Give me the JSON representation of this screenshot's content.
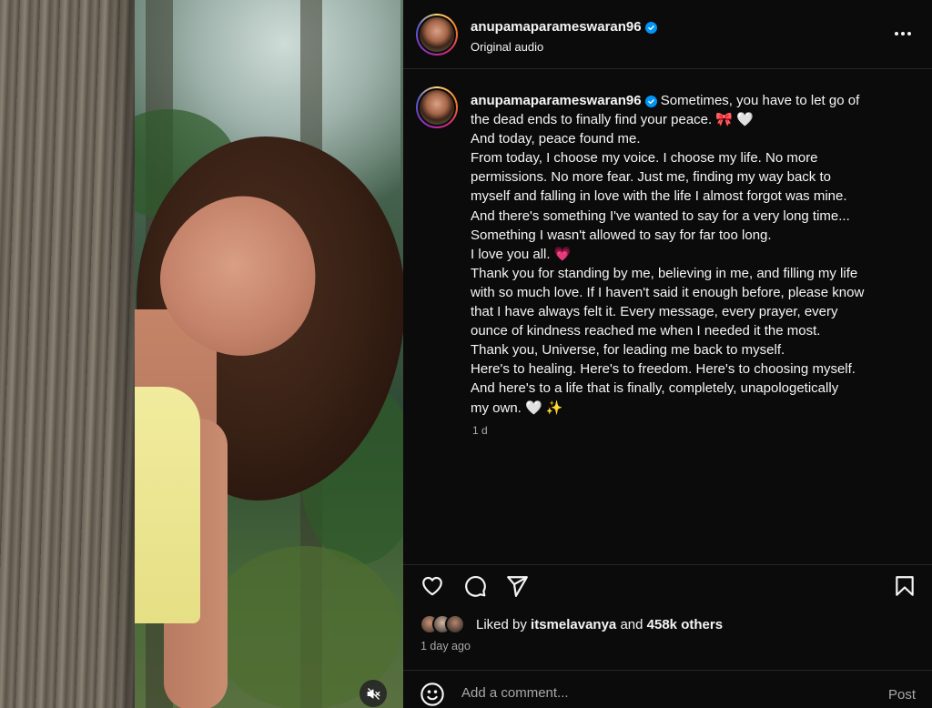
{
  "post": {
    "username": "anupamaparameswaran96",
    "audio": "Original audio",
    "caption_lines": [
      "Sometimes, you have to let go of",
      "the dead ends to finally find your peace. 🎀 🤍",
      "And today, peace found me.",
      "From today, I choose my voice. I choose my life. No more",
      "permissions. No more fear. Just me, finding my way back to",
      "myself and falling in love with the life I almost forgot was mine.",
      "And there's something I've wanted to say for a very long time...",
      "Something I wasn't allowed to say for far too long.",
      "I love you all. 💗",
      "Thank you for standing by me, believing in me, and filling my life",
      "with so much love. If I haven't said it enough before, please know",
      "that I have always felt it. Every message, every prayer, every",
      "ounce of kindness reached me when I needed it the most.",
      "Thank you, Universe, for leading me back to myself.",
      "Here's to healing. Here's to freedom. Here's to choosing myself.",
      "And here's to a life that is finally, completely, unapologetically",
      "my own. 🤍 ✨"
    ],
    "caption_age": "1 d",
    "likes": {
      "prefix": "Liked by",
      "user": "itsmelavanya",
      "joiner": "and",
      "count": "458k others"
    },
    "time_ago": "1 day ago"
  },
  "comment": {
    "placeholder": "Add a comment...",
    "post_label": "Post"
  },
  "icons": {
    "more": "more-options-icon",
    "like": "heart-icon",
    "comment": "comment-bubble-icon",
    "share": "paper-plane-icon",
    "save": "bookmark-icon",
    "emoji": "smiley-icon",
    "mute": "speaker-muted-icon",
    "verified": "verified-badge-icon"
  },
  "colors": {
    "background": "#0b0b0b",
    "text": "#f5f5f5",
    "muted": "#a8a8a8",
    "verified": "#0095f6",
    "divider": "#262626"
  }
}
